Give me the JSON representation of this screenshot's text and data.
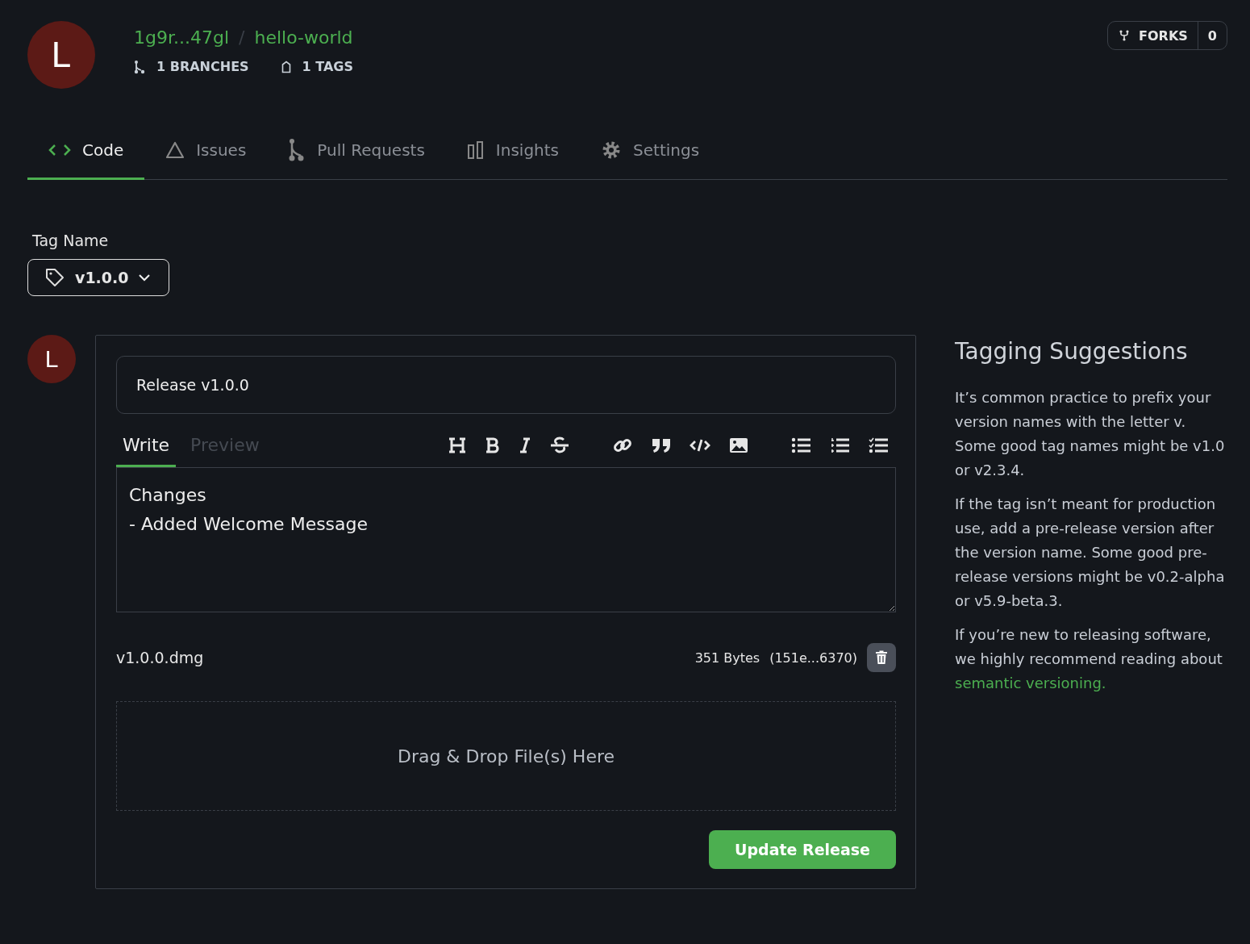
{
  "repo": {
    "avatar_letter": "L",
    "owner": "1g9r...47gl",
    "separator": "/",
    "name": "hello-world",
    "branches": "1 BRANCHES",
    "tags": "1 TAGS"
  },
  "forks": {
    "label": "FORKS",
    "count": "0"
  },
  "tabs": [
    {
      "kind": "code",
      "label": "Code",
      "selected": true
    },
    {
      "kind": "issues",
      "label": "Issues",
      "selected": false
    },
    {
      "kind": "pulls",
      "label": "Pull Requests",
      "selected": false
    },
    {
      "kind": "insights",
      "label": "Insights",
      "selected": false
    },
    {
      "kind": "settings",
      "label": "Settings",
      "selected": false
    }
  ],
  "tag_name": {
    "label": "Tag Name",
    "value": "v1.0.0"
  },
  "release": {
    "avatar_letter": "L",
    "title": "Release v1.0.0",
    "editor_tabs": [
      {
        "label": "Write",
        "selected": true
      },
      {
        "label": "Preview",
        "selected": false
      }
    ],
    "toolbar": [
      {
        "kind": "heading"
      },
      {
        "kind": "bold"
      },
      {
        "kind": "italic"
      },
      {
        "kind": "strike"
      },
      {
        "kind": "gap"
      },
      {
        "kind": "link"
      },
      {
        "kind": "quote"
      },
      {
        "kind": "code"
      },
      {
        "kind": "image"
      },
      {
        "kind": "gap"
      },
      {
        "kind": "ul"
      },
      {
        "kind": "ol"
      },
      {
        "kind": "tasks"
      }
    ],
    "body": "Changes\n- Added Welcome Message",
    "file": {
      "name": "v1.0.0.dmg",
      "size": "351 Bytes",
      "hash": "(151e...6370)"
    },
    "drop_label": "Drag & Drop File(s) Here",
    "submit": "Update Release"
  },
  "suggestions": {
    "title": "Tagging Suggestions",
    "paragraphs": [
      {
        "text": "It’s common practice to prefix your version names with the letter v. Some good tag names might be v1.0 or v2.3.4."
      },
      {
        "text": "If the tag isn’t meant for production use, add a pre-release version after the version name. Some good pre-release versions might be v0.2-alpha or v5.9-beta.3."
      },
      {
        "text": "If you’re new to releasing software, we highly recommend reading about",
        "link": "semantic versioning."
      }
    ]
  }
}
